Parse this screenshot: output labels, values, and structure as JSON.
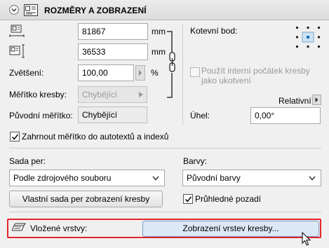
{
  "header": {
    "title": "ROZMĚRY A ZOBRAZENÍ"
  },
  "dimensions": {
    "width_value": "81867",
    "width_unit": "mm",
    "height_value": "36533",
    "height_unit": "mm"
  },
  "scale": {
    "magnify_label": "Zvětšení:",
    "magnify_value": "100,00",
    "magnify_unit": "%",
    "drawing_scale_label": "Měřítko kresby:",
    "drawing_scale_value": "Chybějící",
    "original_scale_label": "Původní měřítko:",
    "original_scale_value": "Chybějící"
  },
  "anchor": {
    "label": "Kotevní bod:",
    "internal_origin_label": "Použít interní počátek kresby jako ukotvení",
    "relative_label": "Relativní",
    "angle_label": "Úhel:",
    "angle_value": "0,00°"
  },
  "autotext": {
    "label": "Zahrnout měřítko do autotextů a indexů",
    "checked": true
  },
  "pen_set": {
    "label": "Sada per:",
    "value": "Podle zdrojového souboru",
    "button_label": "Vlastní sada per zobrazení kresby"
  },
  "colors": {
    "label": "Barvy:",
    "value": "Původní barvy",
    "transparent_label": "Průhledné pozadí",
    "transparent_checked": true
  },
  "layers": {
    "label": "Vložené vrstvy:",
    "button_label": "Zobrazení vrstev kresby...",
    "highlight_color": "#e3262a"
  }
}
